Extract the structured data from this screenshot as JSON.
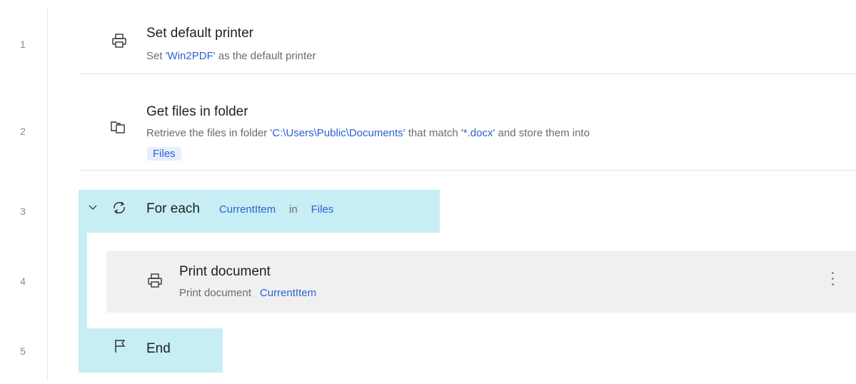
{
  "lines": [
    "1",
    "2",
    "3",
    "4",
    "5"
  ],
  "steps": {
    "set_printer": {
      "title": "Set default printer",
      "desc_prefix": "Set ",
      "printer": "'Win2PDF'",
      "desc_suffix": " as the default printer"
    },
    "get_files": {
      "title": "Get files in folder",
      "desc_prefix": "Retrieve the files in folder ",
      "folder": "'C:\\Users\\Public\\Documents'",
      "desc_mid": " that match ",
      "pattern": "'*.docx'",
      "desc_suffix": " and store them into",
      "output_var": "Files"
    },
    "for_each": {
      "title": "For each",
      "item_var": "CurrentItem",
      "in_label": "in",
      "collection_var": "Files"
    },
    "print_document": {
      "title": "Print document",
      "desc_prefix": "Print document",
      "item_var": "CurrentItem"
    },
    "end": {
      "title": "End"
    }
  },
  "icons": {
    "step1": "printer-icon",
    "step2": "folder-files-icon",
    "step3": "loop-icon",
    "step4": "printer-icon",
    "step5": "flag-icon",
    "collapse": "chevron-down-icon",
    "more": "more-options-icon"
  },
  "colors": {
    "variable": "#2b62d0",
    "loop_highlight": "#c7eef4",
    "selected_row": "#f0f0f0"
  }
}
